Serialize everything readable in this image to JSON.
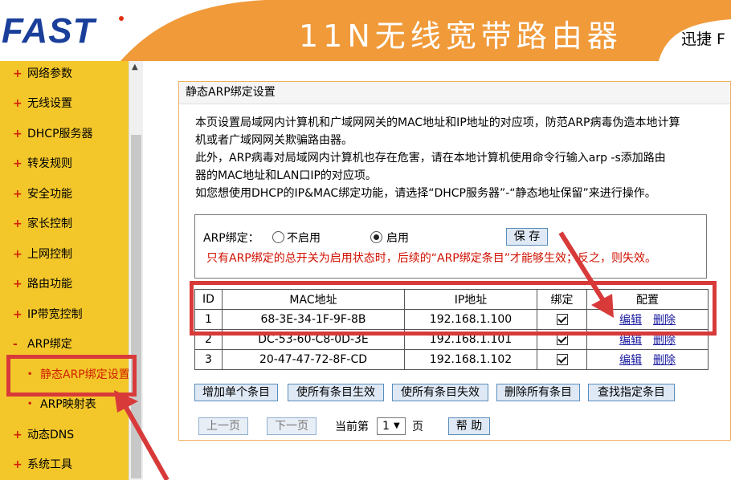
{
  "header": {
    "logo": "FAST",
    "title": "11N无线宽带路由器",
    "subtitle": "迅捷 F"
  },
  "sidebar": {
    "items": [
      {
        "label": "网络参数"
      },
      {
        "label": "无线设置"
      },
      {
        "label": "DHCP服务器"
      },
      {
        "label": "转发规则"
      },
      {
        "label": "安全功能"
      },
      {
        "label": "家长控制"
      },
      {
        "label": "上网控制"
      },
      {
        "label": "路由功能"
      },
      {
        "label": "IP带宽控制"
      },
      {
        "label": "ARP绑定"
      },
      {
        "label": "静态ARP绑定设置"
      },
      {
        "label": "ARP映射表"
      },
      {
        "label": "动态DNS"
      },
      {
        "label": "系统工具"
      }
    ],
    "marks": {
      "plus": "+",
      "minus": "-",
      "dot": "•"
    }
  },
  "panel": {
    "title": "静态ARP绑定设置",
    "description": [
      "本页设置局域网内计算机和广域网网关的MAC地址和IP地址的对应项，防范ARP病毒伪造本地计算",
      "机或者广域网网关欺骗路由器。",
      "此外，ARP病毒对局域网内计算机也存在危害，请在本地计算机使用命令行输入arp -s添加路由",
      "器的MAC地址和LAN口IP的对应项。",
      "如您想使用DHCP的IP&MAC绑定功能，请选择“DHCP服务器”-“静态地址保留”来进行操作。"
    ],
    "arp_switch": {
      "label": "ARP绑定：",
      "options": [
        "不启用",
        "启用"
      ],
      "selected": "启用",
      "save_label": "保 存",
      "warning": "只有ARP绑定的总开关为启用状态时，后续的“ARP绑定条目”才能够生效；反之，则失效。"
    },
    "table": {
      "headers": [
        "ID",
        "MAC地址",
        "IP地址",
        "绑定",
        "配置"
      ],
      "rows": [
        {
          "id": "1",
          "mac": "68-3E-34-1F-9F-8B",
          "ip": "192.168.1.100",
          "bound": true
        },
        {
          "id": "2",
          "mac": "DC-53-60-C8-0D-3E",
          "ip": "192.168.1.101",
          "bound": true
        },
        {
          "id": "3",
          "mac": "20-47-47-72-8F-CD",
          "ip": "192.168.1.102",
          "bound": true
        }
      ],
      "edit_label": "编辑",
      "delete_label": "删除"
    },
    "actions": [
      "增加单个条目",
      "使所有条目生效",
      "使所有条目失效",
      "删除所有条目",
      "查找指定条目"
    ],
    "pager": {
      "prev_label": "上一页",
      "next_label": "下一页",
      "current_label": "当前第",
      "page_value": "1",
      "page_unit": "页",
      "help_label": "帮 助"
    }
  },
  "colors": {
    "header_orange": "#f09a3a",
    "sidebar_yellow": "#f3c72a",
    "annotation_red": "#d83a3a",
    "warning_red": "#d01000",
    "logo_blue": "#1a3f9a"
  }
}
